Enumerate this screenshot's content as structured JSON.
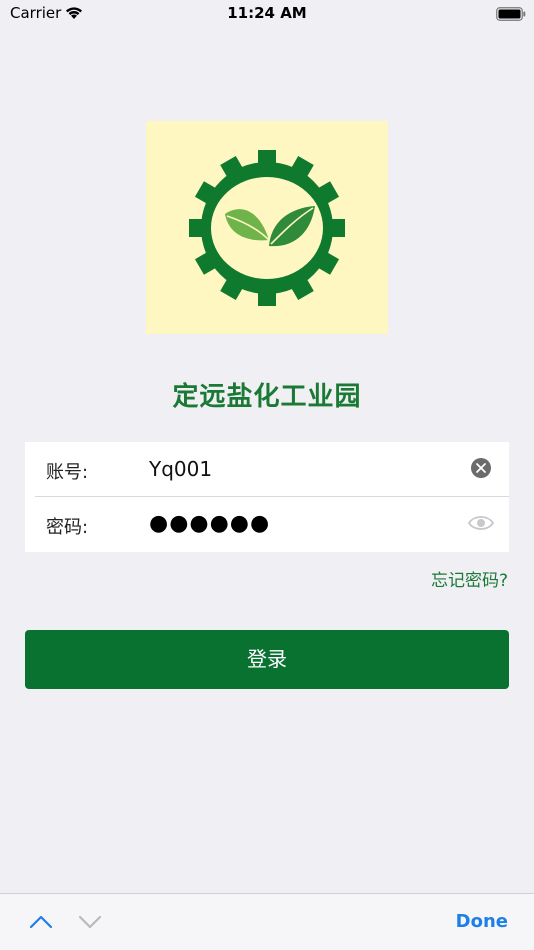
{
  "status_bar": {
    "carrier": "Carrier",
    "time": "11:24 AM"
  },
  "logo": {
    "background_color": "#fff7c2",
    "gear_color": "#0f7a2e",
    "leaf_light_color": "#6fb44a",
    "leaf_dark_color": "#2f8a3a",
    "icon": "gear-with-leaves-icon"
  },
  "app": {
    "title": "定远盐化工业园"
  },
  "form": {
    "account_label": "账号:",
    "account_value": "Yq001",
    "password_label": "密码:",
    "password_masked": "●●●●●●",
    "clear_icon": "clear-icon",
    "visibility_icon": "eye-icon"
  },
  "links": {
    "forgot_password": "忘记密码?"
  },
  "actions": {
    "login_label": "登录"
  },
  "accessory_bar": {
    "done_label": "Done",
    "prev_icon": "chevron-up-icon",
    "next_icon": "chevron-down-icon"
  },
  "colors": {
    "brand_green": "#097230",
    "link_green": "#1a7a35",
    "ios_blue": "#1e7fe6",
    "background": "#efeff4"
  }
}
